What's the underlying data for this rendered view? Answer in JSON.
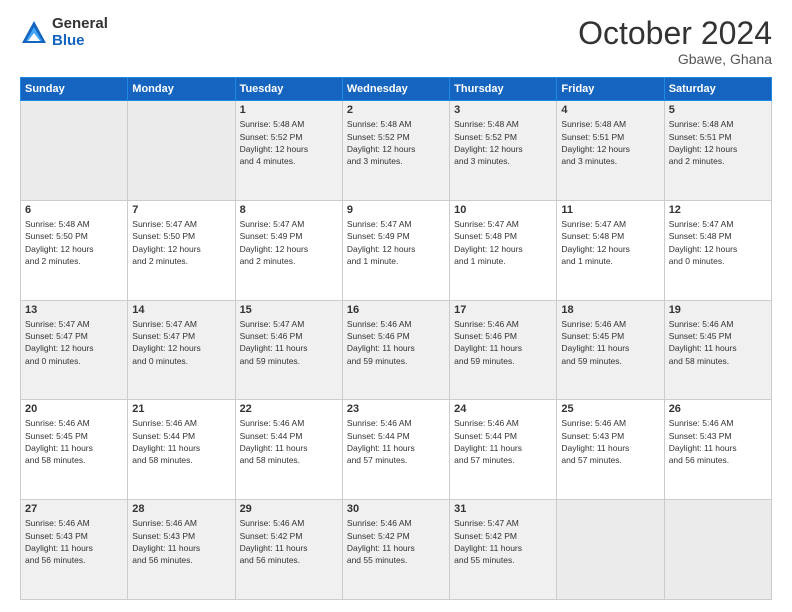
{
  "logo": {
    "general": "General",
    "blue": "Blue"
  },
  "title": "October 2024",
  "subtitle": "Gbawe, Ghana",
  "days_of_week": [
    "Sunday",
    "Monday",
    "Tuesday",
    "Wednesday",
    "Thursday",
    "Friday",
    "Saturday"
  ],
  "weeks": [
    [
      {
        "day": null,
        "info": null
      },
      {
        "day": null,
        "info": null
      },
      {
        "day": "1",
        "info": "Sunrise: 5:48 AM\nSunset: 5:52 PM\nDaylight: 12 hours\nand 4 minutes."
      },
      {
        "day": "2",
        "info": "Sunrise: 5:48 AM\nSunset: 5:52 PM\nDaylight: 12 hours\nand 3 minutes."
      },
      {
        "day": "3",
        "info": "Sunrise: 5:48 AM\nSunset: 5:52 PM\nDaylight: 12 hours\nand 3 minutes."
      },
      {
        "day": "4",
        "info": "Sunrise: 5:48 AM\nSunset: 5:51 PM\nDaylight: 12 hours\nand 3 minutes."
      },
      {
        "day": "5",
        "info": "Sunrise: 5:48 AM\nSunset: 5:51 PM\nDaylight: 12 hours\nand 2 minutes."
      }
    ],
    [
      {
        "day": "6",
        "info": "Sunrise: 5:48 AM\nSunset: 5:50 PM\nDaylight: 12 hours\nand 2 minutes."
      },
      {
        "day": "7",
        "info": "Sunrise: 5:47 AM\nSunset: 5:50 PM\nDaylight: 12 hours\nand 2 minutes."
      },
      {
        "day": "8",
        "info": "Sunrise: 5:47 AM\nSunset: 5:49 PM\nDaylight: 12 hours\nand 2 minutes."
      },
      {
        "day": "9",
        "info": "Sunrise: 5:47 AM\nSunset: 5:49 PM\nDaylight: 12 hours\nand 1 minute."
      },
      {
        "day": "10",
        "info": "Sunrise: 5:47 AM\nSunset: 5:48 PM\nDaylight: 12 hours\nand 1 minute."
      },
      {
        "day": "11",
        "info": "Sunrise: 5:47 AM\nSunset: 5:48 PM\nDaylight: 12 hours\nand 1 minute."
      },
      {
        "day": "12",
        "info": "Sunrise: 5:47 AM\nSunset: 5:48 PM\nDaylight: 12 hours\nand 0 minutes."
      }
    ],
    [
      {
        "day": "13",
        "info": "Sunrise: 5:47 AM\nSunset: 5:47 PM\nDaylight: 12 hours\nand 0 minutes."
      },
      {
        "day": "14",
        "info": "Sunrise: 5:47 AM\nSunset: 5:47 PM\nDaylight: 12 hours\nand 0 minutes."
      },
      {
        "day": "15",
        "info": "Sunrise: 5:47 AM\nSunset: 5:46 PM\nDaylight: 11 hours\nand 59 minutes."
      },
      {
        "day": "16",
        "info": "Sunrise: 5:46 AM\nSunset: 5:46 PM\nDaylight: 11 hours\nand 59 minutes."
      },
      {
        "day": "17",
        "info": "Sunrise: 5:46 AM\nSunset: 5:46 PM\nDaylight: 11 hours\nand 59 minutes."
      },
      {
        "day": "18",
        "info": "Sunrise: 5:46 AM\nSunset: 5:45 PM\nDaylight: 11 hours\nand 59 minutes."
      },
      {
        "day": "19",
        "info": "Sunrise: 5:46 AM\nSunset: 5:45 PM\nDaylight: 11 hours\nand 58 minutes."
      }
    ],
    [
      {
        "day": "20",
        "info": "Sunrise: 5:46 AM\nSunset: 5:45 PM\nDaylight: 11 hours\nand 58 minutes."
      },
      {
        "day": "21",
        "info": "Sunrise: 5:46 AM\nSunset: 5:44 PM\nDaylight: 11 hours\nand 58 minutes."
      },
      {
        "day": "22",
        "info": "Sunrise: 5:46 AM\nSunset: 5:44 PM\nDaylight: 11 hours\nand 58 minutes."
      },
      {
        "day": "23",
        "info": "Sunrise: 5:46 AM\nSunset: 5:44 PM\nDaylight: 11 hours\nand 57 minutes."
      },
      {
        "day": "24",
        "info": "Sunrise: 5:46 AM\nSunset: 5:44 PM\nDaylight: 11 hours\nand 57 minutes."
      },
      {
        "day": "25",
        "info": "Sunrise: 5:46 AM\nSunset: 5:43 PM\nDaylight: 11 hours\nand 57 minutes."
      },
      {
        "day": "26",
        "info": "Sunrise: 5:46 AM\nSunset: 5:43 PM\nDaylight: 11 hours\nand 56 minutes."
      }
    ],
    [
      {
        "day": "27",
        "info": "Sunrise: 5:46 AM\nSunset: 5:43 PM\nDaylight: 11 hours\nand 56 minutes."
      },
      {
        "day": "28",
        "info": "Sunrise: 5:46 AM\nSunset: 5:43 PM\nDaylight: 11 hours\nand 56 minutes."
      },
      {
        "day": "29",
        "info": "Sunrise: 5:46 AM\nSunset: 5:42 PM\nDaylight: 11 hours\nand 56 minutes."
      },
      {
        "day": "30",
        "info": "Sunrise: 5:46 AM\nSunset: 5:42 PM\nDaylight: 11 hours\nand 55 minutes."
      },
      {
        "day": "31",
        "info": "Sunrise: 5:47 AM\nSunset: 5:42 PM\nDaylight: 11 hours\nand 55 minutes."
      },
      {
        "day": null,
        "info": null
      },
      {
        "day": null,
        "info": null
      }
    ]
  ]
}
